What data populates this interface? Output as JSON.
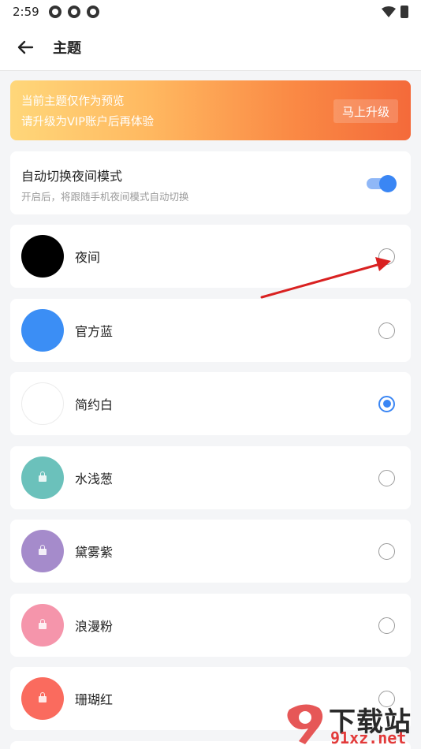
{
  "status_bar": {
    "time": "2:59"
  },
  "header": {
    "title": "主题"
  },
  "banner": {
    "line1": "当前主题仅作为预览",
    "line2": "请升级为VIP账户后再体验",
    "button": "马上升级"
  },
  "auto_night": {
    "title": "自动切换夜间模式",
    "subtitle": "开启后，将跟随手机夜间模式自动切换",
    "enabled": true
  },
  "themes": [
    {
      "label": "夜间",
      "color": "#000000",
      "locked": false,
      "selected": false
    },
    {
      "label": "官方蓝",
      "color": "#3b8ef5",
      "locked": false,
      "selected": false
    },
    {
      "label": "简约白",
      "color": "#ffffff",
      "locked": false,
      "selected": true
    },
    {
      "label": "水浅葱",
      "color": "#6bc1bb",
      "locked": true,
      "selected": false
    },
    {
      "label": "黛雾紫",
      "color": "#a58bcb",
      "locked": true,
      "selected": false
    },
    {
      "label": "浪漫粉",
      "color": "#f595ab",
      "locked": true,
      "selected": false
    },
    {
      "label": "珊瑚红",
      "color": "#fa6b5e",
      "locked": true,
      "selected": false
    }
  ],
  "colors": {
    "accent": "#3a86f4",
    "annotation_arrow": "#d92121"
  },
  "watermark": {
    "big": "下载站",
    "small": "91xz.net",
    "logo_text": "9"
  }
}
